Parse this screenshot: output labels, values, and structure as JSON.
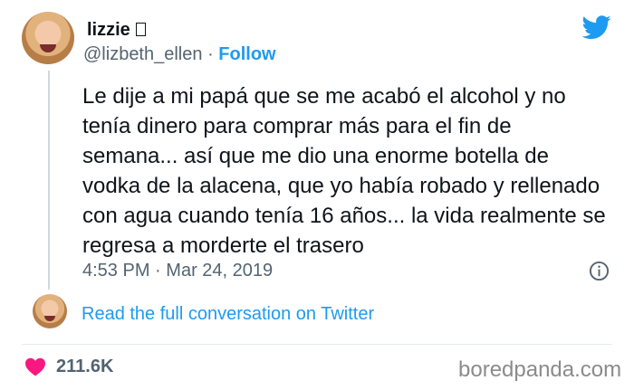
{
  "author": {
    "name": "lizzie",
    "handle": "@lizbeth_ellen",
    "separator": "·",
    "follow_label": "Follow"
  },
  "tweet": {
    "text": "Le dije a mi papá que se me acabó el alcohol y no tenía dinero para comprar más para el fin de semana... así que me dio una enorme botella de vodka de la alacena, que yo había robado y rellenado con agua cuando tenía 16 años... la vida realmente se regresa a morderte el trasero",
    "time": "4:53 PM",
    "separator": "·",
    "date": "Mar 24, 2019"
  },
  "thread": {
    "link_label": "Read the full conversation on Twitter"
  },
  "stats": {
    "likes": "211.6K"
  },
  "watermark": "boredpanda.com",
  "icons": {
    "brand": "twitter-bird-icon",
    "info": "info-icon",
    "like": "heart-icon"
  },
  "colors": {
    "accent": "#1d9bf0",
    "muted": "#536471",
    "heart": "#f91880",
    "text": "#0f1419"
  }
}
